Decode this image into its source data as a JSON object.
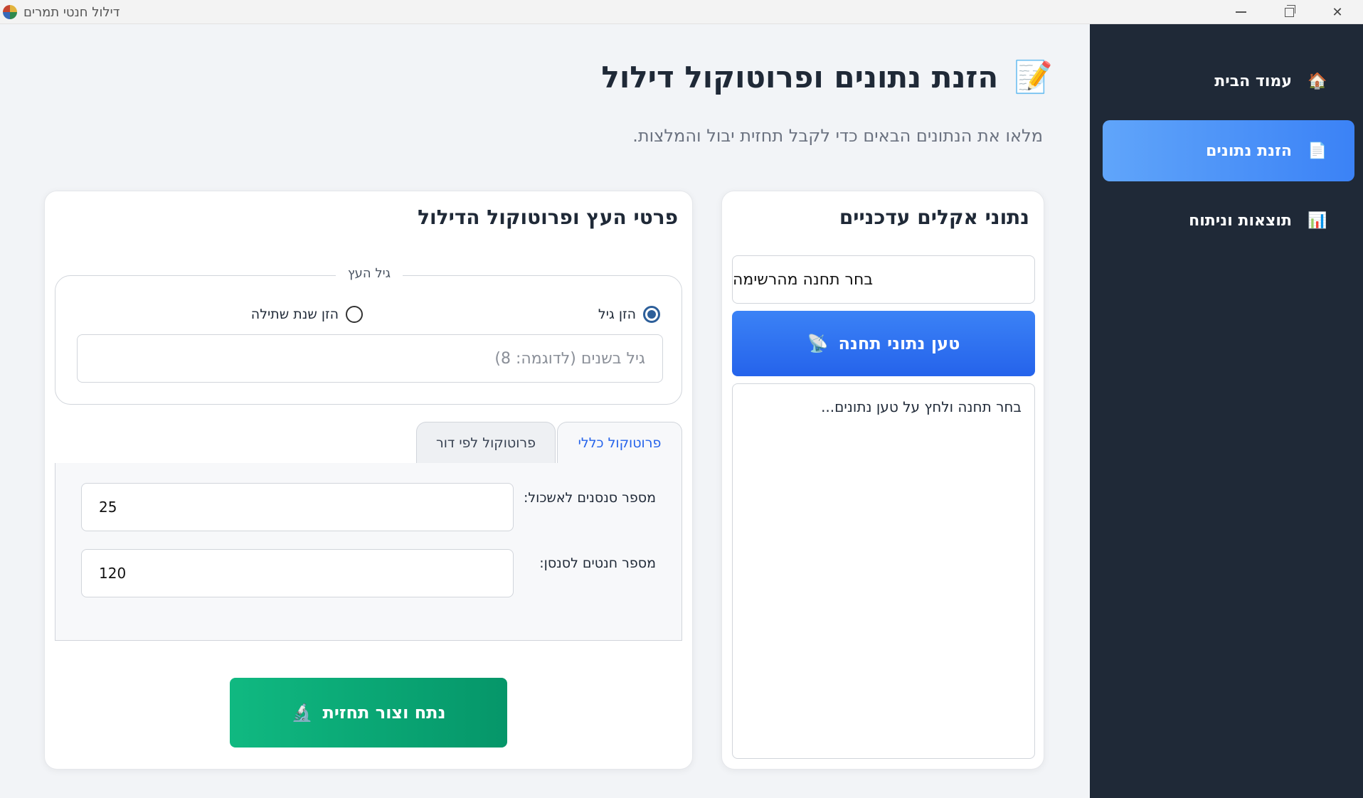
{
  "window": {
    "title": "דילול חנטי תמרים"
  },
  "sidebar": {
    "items": [
      {
        "label": "עמוד הבית",
        "icon": "🏠",
        "active": false
      },
      {
        "label": "הזנת נתונים",
        "icon": "📄",
        "active": true
      },
      {
        "label": "תוצאות וניתוח",
        "icon": "📊",
        "active": false
      }
    ]
  },
  "header": {
    "title": "הזנת נתונים ופרוטוקול דילול",
    "icon": "📝",
    "subtitle": "מלאו את הנתונים הבאים כדי לקבל תחזית יבול והמלצות."
  },
  "climate": {
    "title": "נתוני אקלים עדכניים",
    "station_select": "בחר תחנה מהרשימה",
    "load_button": "טען נתוני תחנה",
    "load_icon": "📡",
    "results_text": "בחר תחנה ולחץ על טען נתונים..."
  },
  "tree": {
    "title": "פרטי העץ ופרוטוקול הדילול",
    "age_group": {
      "legend": "גיל העץ",
      "option_age": "הזן גיל",
      "option_year": "הזן שנת שתילה",
      "selected": "option_age",
      "placeholder": "גיל בשנים (לדוגמה: 8)"
    },
    "tabs": [
      {
        "label": "פרוטוקול כללי",
        "active": true
      },
      {
        "label": "פרוטוקול לפי דור",
        "active": false
      }
    ],
    "fields": {
      "clusters_label": "מספר סנסנים לאשכול:",
      "clusters_value": "25",
      "fruits_label": "מספר חנטים לסנסן:",
      "fruits_value": "120"
    },
    "analyze_button": "נתח וצור תחזית",
    "analyze_icon": "🔬"
  },
  "colors": {
    "sidebar_bg": "#1f2937",
    "active_nav": "#3b82f6",
    "primary_button": "#2563eb",
    "success_button": "#059669"
  }
}
